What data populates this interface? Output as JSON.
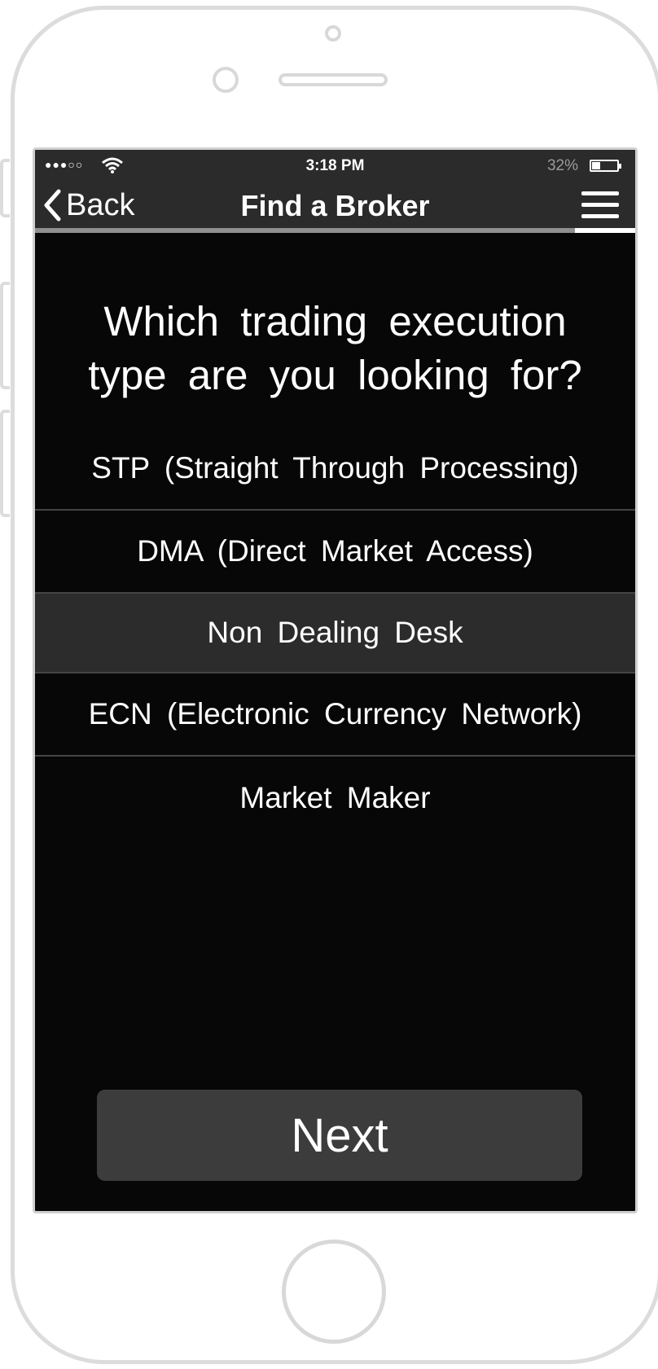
{
  "status_bar": {
    "signal": "●●●○○",
    "time": "3:18 PM",
    "battery_percent": "32%",
    "battery_level": 0.32
  },
  "nav": {
    "back_label": "Back",
    "title": "Find a Broker",
    "progress": 0.1
  },
  "question": "Which trading execution type are you looking for?",
  "options": [
    {
      "label": "STP (Straight Through Processing)"
    },
    {
      "label": "DMA (Direct Market Access)"
    },
    {
      "label": "Non Dealing Desk",
      "selected": true
    },
    {
      "label": "ECN (Electronic Currency Network)"
    },
    {
      "label": "Market Maker"
    }
  ],
  "next_label": "Next",
  "colors": {
    "screen_bg": "#070707",
    "bar_bg": "#2b2b2b",
    "selected_row": "#2c2c2c",
    "button_bg": "#3c3c3c",
    "frame": "#dcdcdc"
  }
}
